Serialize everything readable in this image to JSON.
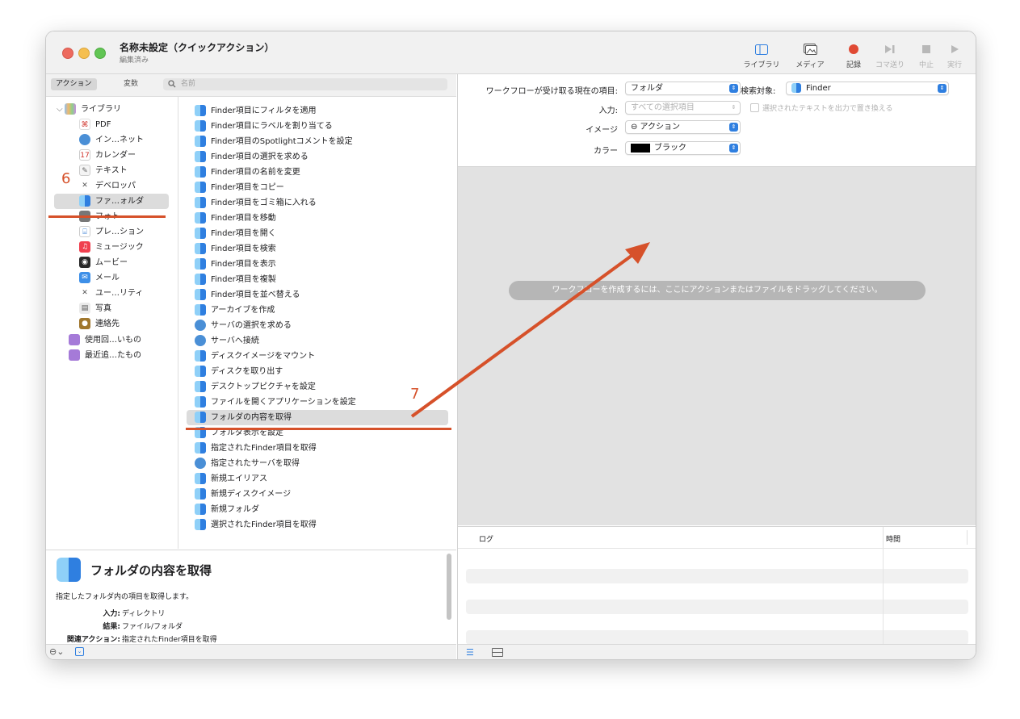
{
  "window": {
    "title": "名称未設定（クイックアクション）",
    "subtitle": "編集済み"
  },
  "toolbar": [
    {
      "label": "ライブラリ",
      "icon": "library-icon",
      "enabled": true
    },
    {
      "label": "メディア",
      "icon": "media-icon",
      "enabled": true
    },
    {
      "label": "記録",
      "icon": "record-icon",
      "enabled": true
    },
    {
      "label": "コマ送り",
      "icon": "step-icon",
      "enabled": false
    },
    {
      "label": "中止",
      "icon": "stop-icon",
      "enabled": false
    },
    {
      "label": "実行",
      "icon": "run-icon",
      "enabled": false
    }
  ],
  "tabs": {
    "actions": "アクション",
    "variables": "変数"
  },
  "search": {
    "placeholder": "名前"
  },
  "library": {
    "root": "ライブラリ",
    "items": [
      "PDF",
      "イン…ネット",
      "カレンダー",
      "テキスト",
      "デベロッパ",
      "ファ…ォルダ",
      "フォト",
      "プレ…ション",
      "ミュージック",
      "ムービー",
      "メール",
      "ユー…リティ",
      "写真",
      "連絡先"
    ],
    "smart_groups": [
      "使用回…いもの",
      "最近追…たもの"
    ],
    "selected_index": 5
  },
  "actions": {
    "items": [
      "Finder項目にフィルタを適用",
      "Finder項目にラベルを割り当てる",
      "Finder項目のSpotlightコメントを設定",
      "Finder項目の選択を求める",
      "Finder項目の名前を変更",
      "Finder項目をコピー",
      "Finder項目をゴミ箱に入れる",
      "Finder項目を移動",
      "Finder項目を開く",
      "Finder項目を検索",
      "Finder項目を表示",
      "Finder項目を複製",
      "Finder項目を並べ替える",
      "アーカイブを作成",
      "サーバの選択を求める",
      "サーバへ接続",
      "ディスクイメージをマウント",
      "ディスクを取り出す",
      "デスクトップピクチャを設定",
      "ファイルを開くアプリケーションを設定",
      "フォルダの内容を取得",
      "フォルダ表示を設定",
      "指定されたFinder項目を取得",
      "指定されたサーバを取得",
      "新規エイリアス",
      "新規ディスクイメージ",
      "新規フォルダ",
      "選択されたFinder項目を取得"
    ],
    "selected_index": 20
  },
  "description": {
    "title": "フォルダの内容を取得",
    "text": "指定したフォルダ内の項目を取得します。",
    "input_label": "入力:",
    "input_value": "ディレクトリ",
    "result_label": "結果:",
    "result_value": "ファイル/フォルダ",
    "related_label": "関連アクション:",
    "related_value": "指定されたFinder項目を取得"
  },
  "options": {
    "receives_label": "ワークフローが受け取る現在の項目:",
    "receives_value": "フォルダ",
    "in_label": "検索対象:",
    "in_value": "Finder",
    "input_label": "入力:",
    "input_value": "すべての選択項目",
    "replace_label": "選択されたテキストを出力で置き換える",
    "image_label": "イメージ",
    "image_value": "⊖ アクション",
    "color_label": "カラー",
    "color_value": "ブラック",
    "color_swatch": "#000000"
  },
  "canvas": {
    "hint": "ワークフローを作成するには、ここにアクションまたはファイルをドラッグしてください。"
  },
  "log": {
    "col_log": "ログ",
    "col_time": "時間"
  },
  "annotations": {
    "step6": "6",
    "step7": "7",
    "color": "#d6512a"
  }
}
